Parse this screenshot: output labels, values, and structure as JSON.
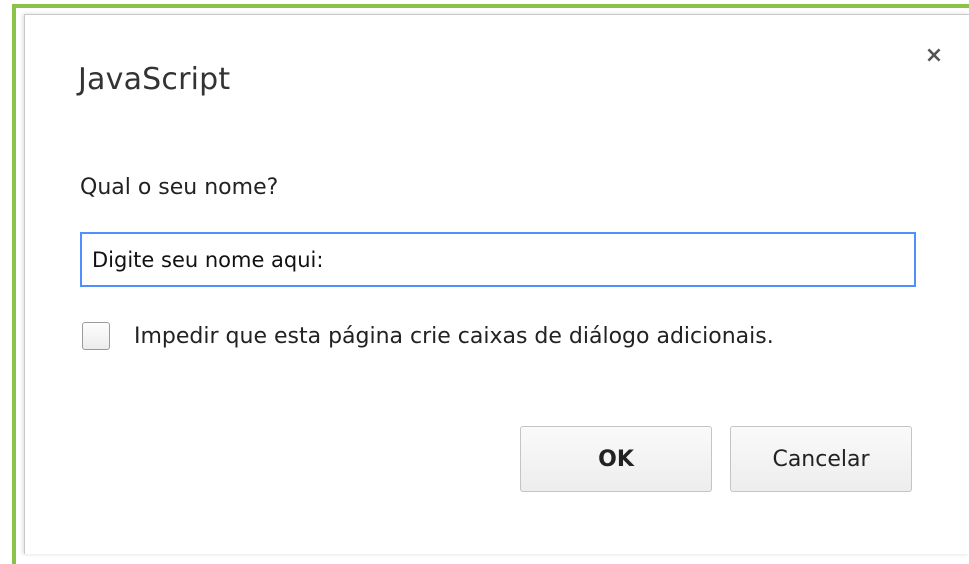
{
  "dialog": {
    "title": "JavaScript",
    "close_label": "×",
    "prompt": "Qual o seu nome?",
    "input_value": "Digite seu nome aqui:",
    "checkbox_label": "Impedir que esta página crie caixas de diálogo adicionais.",
    "checkbox_checked": false,
    "ok_label": "OK",
    "cancel_label": "Cancelar"
  },
  "colors": {
    "accent_border": "#8bc34a",
    "focus_ring": "#4d90fe"
  },
  "icons": {
    "close": "close-icon"
  }
}
